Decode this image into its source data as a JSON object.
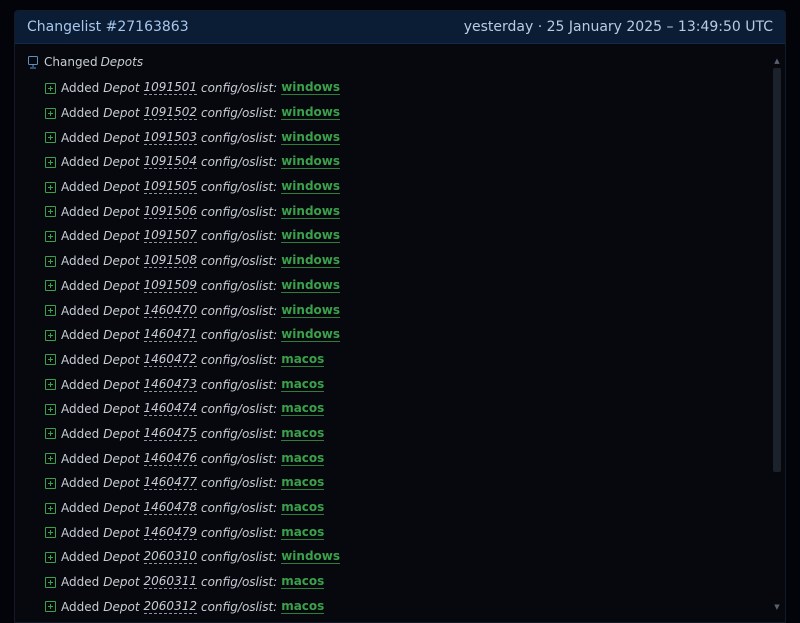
{
  "header": {
    "title": "Changelist #27163863",
    "date": "yesterday · 25 January 2025 – 13:49:50 UTC"
  },
  "root": {
    "label": "Changed",
    "emphasis": "Depots"
  },
  "row_labels": {
    "verb": "Added",
    "keyword": "Depot",
    "path": "config/oslist:"
  },
  "rows": [
    {
      "id": "1091501",
      "os": "windows"
    },
    {
      "id": "1091502",
      "os": "windows"
    },
    {
      "id": "1091503",
      "os": "windows"
    },
    {
      "id": "1091504",
      "os": "windows"
    },
    {
      "id": "1091505",
      "os": "windows"
    },
    {
      "id": "1091506",
      "os": "windows"
    },
    {
      "id": "1091507",
      "os": "windows"
    },
    {
      "id": "1091508",
      "os": "windows"
    },
    {
      "id": "1091509",
      "os": "windows"
    },
    {
      "id": "1460470",
      "os": "windows"
    },
    {
      "id": "1460471",
      "os": "windows"
    },
    {
      "id": "1460472",
      "os": "macos"
    },
    {
      "id": "1460473",
      "os": "macos"
    },
    {
      "id": "1460474",
      "os": "macos"
    },
    {
      "id": "1460475",
      "os": "macos"
    },
    {
      "id": "1460476",
      "os": "macos"
    },
    {
      "id": "1460477",
      "os": "macos"
    },
    {
      "id": "1460478",
      "os": "macos"
    },
    {
      "id": "1460479",
      "os": "macos"
    },
    {
      "id": "2060310",
      "os": "windows"
    },
    {
      "id": "2060311",
      "os": "macos"
    },
    {
      "id": "2060312",
      "os": "macos"
    }
  ],
  "icons": {
    "root": "depot-icon",
    "row": "plus-icon"
  },
  "colors": {
    "accent_green": "#3aa04a",
    "header_bg": "#0a1d35",
    "header_text": "#a9c7ea"
  }
}
